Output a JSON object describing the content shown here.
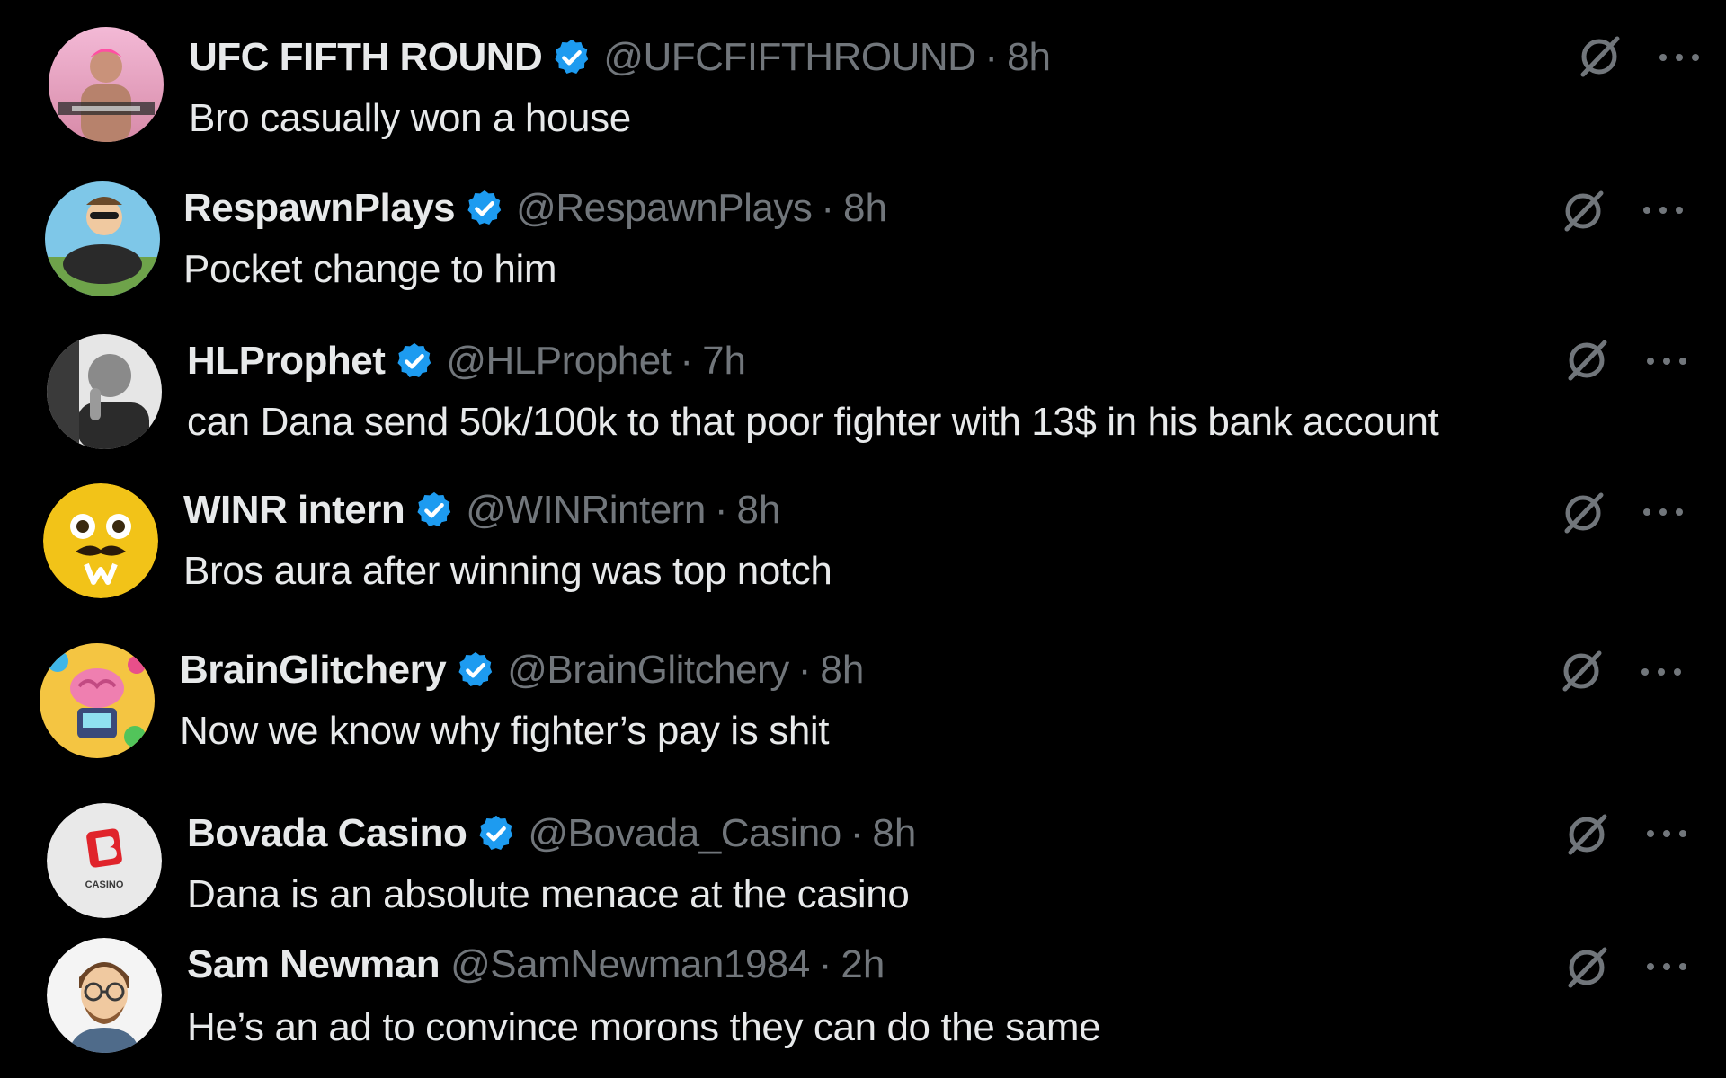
{
  "colors": {
    "background": "#000000",
    "text": "#e7e9ea",
    "muted": "#71767b",
    "verified_badge": "#1d9bf0"
  },
  "replies": [
    {
      "name": "UFC FIFTH ROUND",
      "verified": true,
      "handle": "@UFCFIFTHROUND",
      "separator": "·",
      "time": "8h",
      "text": "Bro casually won a house",
      "avatar_icon": "fighter-avatar-icon"
    },
    {
      "name": "RespawnPlays",
      "verified": true,
      "handle": "@RespawnPlays",
      "separator": "·",
      "time": "8h",
      "text": "Pocket change to him",
      "avatar_icon": "cartoon-rider-avatar-icon"
    },
    {
      "name": "HLProphet",
      "verified": true,
      "handle": "@HLProphet",
      "separator": "·",
      "time": "7h",
      "text": "can Dana send 50k/100k to that poor fighter with 13$ in his bank account",
      "avatar_icon": "thinking-man-avatar-icon"
    },
    {
      "name": "WINR intern",
      "verified": true,
      "handle": "@WINRintern",
      "separator": "·",
      "time": "8h",
      "text": "Bros aura after winning was top notch",
      "avatar_icon": "mustache-emoji-avatar-icon"
    },
    {
      "name": "BrainGlitchery",
      "verified": true,
      "handle": "@BrainGlitchery",
      "separator": "·",
      "time": "8h",
      "text": "Now we know why fighter’s pay is shit",
      "avatar_icon": "brain-robot-avatar-icon"
    },
    {
      "name": "Bovada Casino",
      "verified": true,
      "handle": "@Bovada_Casino",
      "separator": "·",
      "time": "8h",
      "text": "Dana is an absolute menace at the casino",
      "avatar_icon": "casino-logo-avatar-icon",
      "avatar_logo_text": "CASINO"
    },
    {
      "name": "Sam Newman",
      "verified": false,
      "handle": "@SamNewman1984",
      "separator": "·",
      "time": "2h",
      "text": "He’s an ad to convince morons they can do the same",
      "avatar_icon": "cartoon-man-avatar-icon"
    }
  ]
}
